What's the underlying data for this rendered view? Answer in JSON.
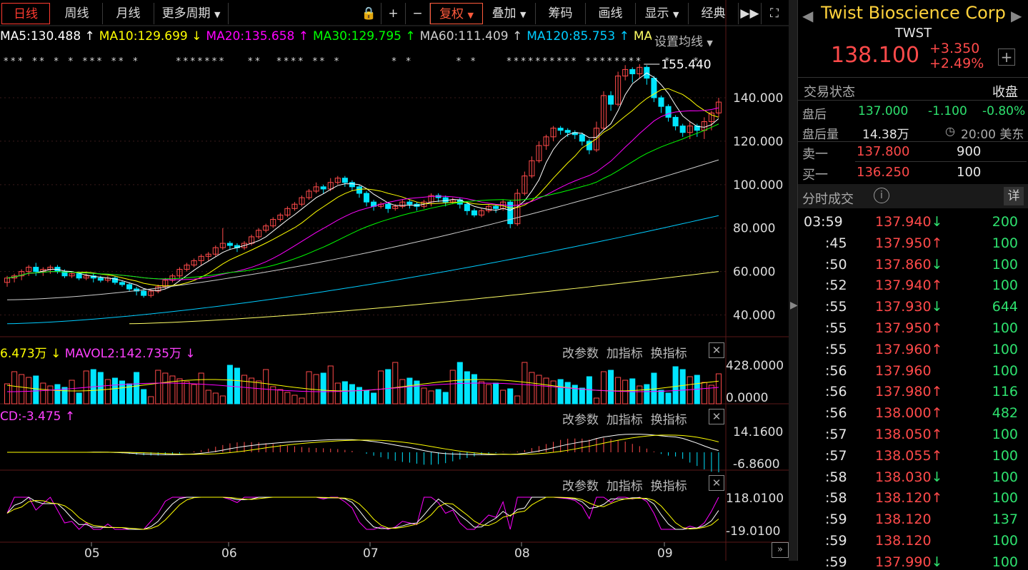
{
  "toolbar": {
    "day": "日线",
    "week": "周线",
    "month": "月线",
    "more": "更多周期",
    "adjust": "复权",
    "overlay": "叠加",
    "chips": "筹码",
    "draw": "画线",
    "display": "显示",
    "classic": "经典"
  },
  "ma_legend": [
    {
      "text": "MA5:130.488",
      "arrow": "up",
      "color": "#ffffff"
    },
    {
      "text": "MA10:129.699",
      "arrow": "down",
      "color": "#ffff00"
    },
    {
      "text": "MA20:135.658",
      "arrow": "up",
      "color": "#ff00ff"
    },
    {
      "text": "MA30:129.795",
      "arrow": "up",
      "color": "#00ff00"
    },
    {
      "text": "MA60:111.409",
      "arrow": "up",
      "color": "#cccccc"
    },
    {
      "text": "MA120:85.753",
      "arrow": "up",
      "color": "#00ccff"
    },
    {
      "text": "MA",
      "arrow": "",
      "color": "#ffff66"
    }
  ],
  "ma_setting": "设置均线",
  "vol_legend": {
    "a": "6.473万",
    "b": "MAVOL2:142.735万"
  },
  "macd_legend": "CD:-3.475",
  "panel_actions": {
    "edit": "改参数",
    "add": "加指标",
    "swap": "换指标"
  },
  "chart_data": {
    "type": "candlestick",
    "title": "",
    "y_ticks": [
      "140.000",
      "120.000",
      "100.000",
      "80.000",
      "60.000",
      "40.000"
    ],
    "ylim": [
      30,
      162
    ],
    "x_ticks": [
      "05",
      "06",
      "07",
      "08",
      "09"
    ],
    "high_label": "155.440",
    "vol_ticks": [
      "428.0000",
      "0.0000"
    ],
    "macd_ticks": [
      "14.1600",
      "-6.8600"
    ],
    "osc_ticks": [
      "118.0100",
      "-19.0100"
    ],
    "candles": [
      [
        55,
        57,
        53,
        58
      ],
      [
        57,
        58,
        55,
        59
      ],
      [
        58,
        60,
        56,
        61
      ],
      [
        60,
        62,
        58,
        63
      ],
      [
        62,
        60,
        58,
        64
      ],
      [
        60,
        61,
        58,
        62
      ],
      [
        61,
        62,
        59,
        63
      ],
      [
        62,
        60,
        59,
        63
      ],
      [
        60,
        58,
        57,
        61
      ],
      [
        58,
        59,
        57,
        60
      ],
      [
        59,
        57,
        56,
        60
      ],
      [
        57,
        58,
        56,
        59
      ],
      [
        58,
        57,
        55,
        59
      ],
      [
        57,
        56,
        55,
        58
      ],
      [
        56,
        57,
        55,
        58
      ],
      [
        57,
        55,
        54,
        58
      ],
      [
        55,
        54,
        53,
        56
      ],
      [
        54,
        52,
        51,
        55
      ],
      [
        52,
        51,
        49,
        53
      ],
      [
        51,
        49,
        48,
        52
      ],
      [
        49,
        51,
        48,
        52
      ],
      [
        51,
        53,
        50,
        54
      ],
      [
        53,
        56,
        52,
        57
      ],
      [
        56,
        58,
        55,
        59
      ],
      [
        58,
        61,
        57,
        62
      ],
      [
        61,
        63,
        60,
        64
      ],
      [
        63,
        65,
        62,
        66
      ],
      [
        65,
        67,
        63,
        68
      ],
      [
        67,
        68,
        65,
        69
      ],
      [
        68,
        71,
        67,
        72
      ],
      [
        71,
        73,
        70,
        80
      ],
      [
        73,
        72,
        70,
        74
      ],
      [
        72,
        71,
        69,
        73
      ],
      [
        71,
        73,
        70,
        74
      ],
      [
        73,
        76,
        72,
        77
      ],
      [
        76,
        79,
        75,
        80
      ],
      [
        79,
        81,
        78,
        82
      ],
      [
        81,
        84,
        80,
        85
      ],
      [
        84,
        86,
        83,
        87
      ],
      [
        86,
        89,
        85,
        90
      ],
      [
        89,
        91,
        88,
        92
      ],
      [
        91,
        94,
        90,
        95
      ],
      [
        94,
        97,
        93,
        98
      ],
      [
        97,
        99,
        96,
        101
      ],
      [
        99,
        98,
        96,
        100
      ],
      [
        98,
        101,
        97,
        103
      ],
      [
        101,
        103,
        100,
        104
      ],
      [
        103,
        101,
        99,
        104
      ],
      [
        101,
        99,
        97,
        102
      ],
      [
        99,
        96,
        94,
        100
      ],
      [
        96,
        92,
        90,
        97
      ],
      [
        92,
        90,
        88,
        93
      ],
      [
        90,
        91,
        89,
        92
      ],
      [
        91,
        89,
        87,
        92
      ],
      [
        89,
        90,
        88,
        91
      ],
      [
        90,
        92,
        89,
        93
      ],
      [
        92,
        91,
        89,
        93
      ],
      [
        91,
        90,
        88,
        92
      ],
      [
        90,
        92,
        89,
        93
      ],
      [
        92,
        95,
        90,
        96
      ],
      [
        95,
        94,
        92,
        96
      ],
      [
        94,
        92,
        90,
        95
      ],
      [
        92,
        93,
        91,
        94
      ],
      [
        93,
        91,
        89,
        94
      ],
      [
        91,
        88,
        86,
        92
      ],
      [
        88,
        86,
        85,
        89
      ],
      [
        86,
        88,
        85,
        89
      ],
      [
        88,
        90,
        87,
        91
      ],
      [
        90,
        89,
        87,
        91
      ],
      [
        89,
        92,
        88,
        93
      ],
      [
        92,
        82,
        80,
        93
      ],
      [
        82,
        96,
        81,
        98
      ],
      [
        96,
        104,
        95,
        106
      ],
      [
        104,
        111,
        103,
        113
      ],
      [
        111,
        118,
        110,
        120
      ],
      [
        118,
        122,
        116,
        123
      ],
      [
        122,
        126,
        120,
        127
      ],
      [
        126,
        125,
        123,
        127
      ],
      [
        125,
        124,
        122,
        126
      ],
      [
        124,
        123,
        121,
        125
      ],
      [
        123,
        120,
        118,
        124
      ],
      [
        120,
        116,
        114,
        121
      ],
      [
        116,
        126,
        115,
        129
      ],
      [
        126,
        141,
        125,
        143
      ],
      [
        141,
        137,
        134,
        143
      ],
      [
        137,
        150,
        136,
        152
      ],
      [
        150,
        153,
        148,
        155
      ],
      [
        153,
        151,
        147,
        154
      ],
      [
        151,
        154,
        149,
        155.44
      ],
      [
        154,
        149,
        146,
        155
      ],
      [
        149,
        140,
        138,
        150
      ],
      [
        140,
        136,
        133,
        141
      ],
      [
        136,
        131,
        129,
        137
      ],
      [
        131,
        127,
        125,
        132
      ],
      [
        127,
        124,
        122,
        128
      ],
      [
        124,
        127,
        121,
        129
      ],
      [
        127,
        125,
        122,
        128
      ],
      [
        125,
        129,
        121,
        131
      ],
      [
        129,
        133,
        125,
        134
      ],
      [
        133,
        138,
        131,
        140
      ]
    ]
  },
  "stock": {
    "name": "Twist Bioscience Corp",
    "code": "TWST",
    "price": "138.100",
    "change": "+3.350",
    "pct": "+2.49%",
    "status_label": "交易状态",
    "status": "收盘",
    "ah_label": "盘后",
    "ah_price": "137.000",
    "ah_change": "-1.100",
    "ah_pct": "-0.80%",
    "ahv_label": "盘后量",
    "ahv": "14.38万",
    "time": "20:00 美东",
    "ask_label": "卖一",
    "ask": "137.800",
    "ask_vol": "900",
    "bid_label": "买一",
    "bid": "136.250",
    "bid_vol": "100",
    "ticks_title": "分时成交",
    "detail": "详"
  },
  "trades": [
    {
      "t": "03:59",
      "p": "137.940",
      "d": "down",
      "v": "200"
    },
    {
      "t": ":45",
      "p": "137.950",
      "d": "up",
      "v": "100"
    },
    {
      "t": ":50",
      "p": "137.860",
      "d": "down",
      "v": "100"
    },
    {
      "t": ":52",
      "p": "137.940",
      "d": "up",
      "v": "100"
    },
    {
      "t": ":55",
      "p": "137.930",
      "d": "down",
      "v": "644"
    },
    {
      "t": ":55",
      "p": "137.950",
      "d": "up",
      "v": "100"
    },
    {
      "t": ":55",
      "p": "137.960",
      "d": "up",
      "v": "100"
    },
    {
      "t": ":56",
      "p": "137.960",
      "d": "",
      "v": "100"
    },
    {
      "t": ":56",
      "p": "137.980",
      "d": "up",
      "v": "116"
    },
    {
      "t": ":56",
      "p": "138.000",
      "d": "up",
      "v": "482"
    },
    {
      "t": ":57",
      "p": "138.050",
      "d": "up",
      "v": "100"
    },
    {
      "t": ":57",
      "p": "138.055",
      "d": "up",
      "v": "100"
    },
    {
      "t": ":58",
      "p": "138.030",
      "d": "down",
      "v": "100"
    },
    {
      "t": ":58",
      "p": "138.120",
      "d": "up",
      "v": "100"
    },
    {
      "t": ":59",
      "p": "138.120",
      "d": "",
      "v": "137"
    },
    {
      "t": ":59",
      "p": "138.120",
      "d": "",
      "v": "100"
    },
    {
      "t": ":59",
      "p": "137.990",
      "d": "down",
      "v": "100"
    }
  ],
  "colors": {
    "up": "#ff4a4a",
    "down": "#00e5ff",
    "grid": "#3a1a1a"
  }
}
